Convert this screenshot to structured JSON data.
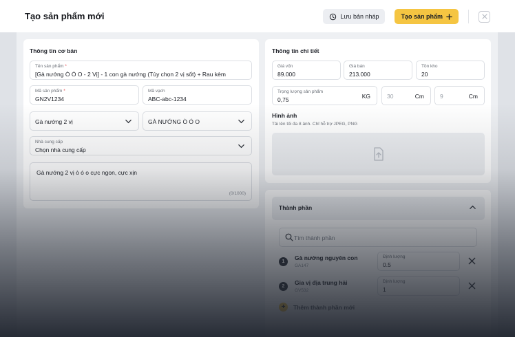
{
  "header": {
    "title": "Tạo sản phẩm mới",
    "save_draft_label": "Lưu bản nháp",
    "create_label": "Tạo sản phẩm",
    "create_icon": "plus-icon",
    "draft_icon": "save-draft-icon",
    "close_icon": "close-icon"
  },
  "basic": {
    "title": "Thông tin cơ bản",
    "name_label": "Tên sản phẩm",
    "name_value": "[Gà nướng Ò Ó O - 2 Vị] - 1 con gà nướng (Tùy chọn 2 vị sốt) + Rau kèm",
    "code_label": "Mã sản phẩm",
    "code_value": "GN2V1234",
    "barcode_label": "Mã vạch",
    "barcode_value": "ABC-abc-1234",
    "category_value": "Gà nướng 2 vị",
    "brand_value": "GÀ NƯỚNG Ò Ó O",
    "supplier_label": "Nhà cung cấp",
    "supplier_value": "Chọn nhà cung cấp",
    "description_value": "Gà nướng 2 vị ò ó o cực ngon, cực xịn",
    "description_counter": "(0/1000)",
    "required_mark": "*"
  },
  "detail": {
    "title": "Thông tin chi tiết",
    "cost_label": "Giá vốn",
    "cost_value": "89.000",
    "price_label": "Giá bán",
    "price_value": "213.000",
    "stock_label": "Tồn kho",
    "stock_value": "20",
    "weight_label": "Trọng lượng sản phẩm",
    "weight_value": "0,75",
    "weight_unit": "KG",
    "dim1_placeholder": "30",
    "dim1_unit": "Cm",
    "dim2_placeholder": "9",
    "dim2_unit": "Cm",
    "images_title": "Hình ảnh",
    "images_hint": "Tải lên tối đa 8 ảnh. Chỉ hỗ trợ JPEG, PNG"
  },
  "components": {
    "title": "Thành phần",
    "search_placeholder": "Tìm thành phần",
    "qty_label": "Định lượng",
    "items": [
      {
        "index": "1",
        "name": "Gà nướng nguyên con",
        "code": "GA147",
        "qty": "0.5"
      },
      {
        "index": "2",
        "name": "Gia vị địa trung hải",
        "code": "GV532",
        "qty": "1"
      }
    ],
    "add_label": "Thêm thành phần mới",
    "add_symbol": "+"
  },
  "colors": {
    "accent": "#f5c542",
    "required": "#e5484d",
    "dark": "#2b2f37"
  }
}
